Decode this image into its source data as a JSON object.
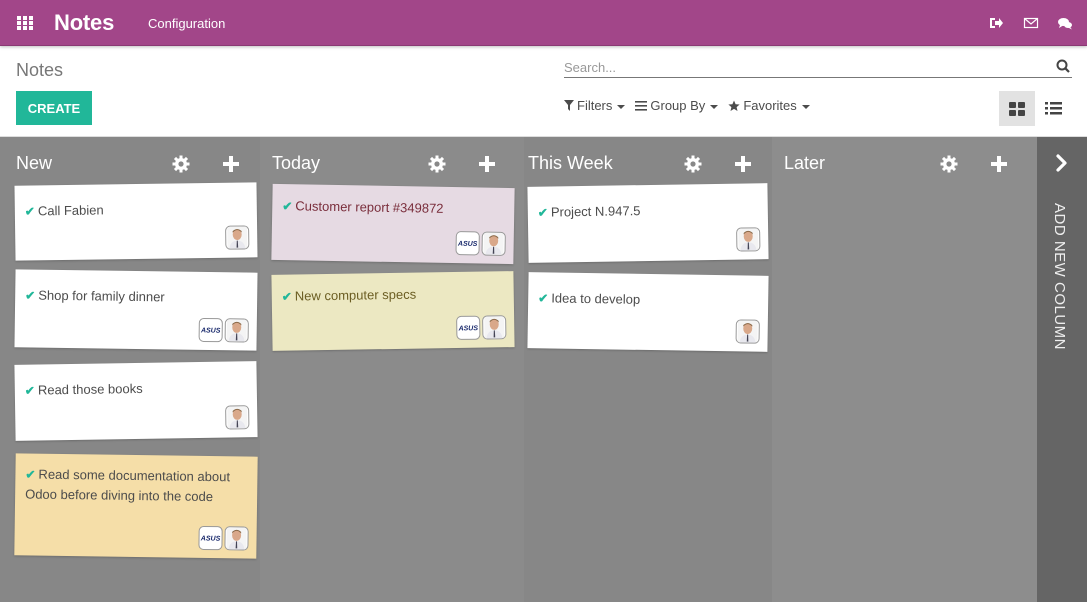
{
  "topbar": {
    "app_title": "Notes",
    "menu": [
      "Configuration"
    ],
    "brand_color": "#a24689",
    "icons": [
      "apps-icon",
      "sign-out-icon",
      "envelope-icon",
      "chat-icon"
    ]
  },
  "control_panel": {
    "breadcrumb": "Notes",
    "create_label": "CREATE",
    "create_color": "#21b799",
    "search": {
      "placeholder": "Search...",
      "value": ""
    },
    "filters_label": "Filters",
    "groupby_label": "Group By",
    "favorites_label": "Favorites",
    "views": [
      "kanban",
      "list"
    ],
    "active_view": "kanban"
  },
  "kanban": {
    "columns": [
      {
        "title": "New",
        "cards": [
          {
            "title": "Call Fabien",
            "color": "#ffffff",
            "text_color": "#4c4c4c",
            "followers": [
              "person"
            ]
          },
          {
            "title": "Shop for family dinner",
            "color": "#ffffff",
            "text_color": "#4c4c4c",
            "followers": [
              "company",
              "person"
            ]
          },
          {
            "title": "Read those books",
            "color": "#ffffff",
            "text_color": "#4c4c4c",
            "followers": [
              "person"
            ]
          },
          {
            "title": "Read some documentation about Odoo before diving into the code",
            "color": "#f5dea8",
            "text_color": "#4c4c4c",
            "followers": [
              "company",
              "person"
            ]
          }
        ]
      },
      {
        "title": "Today",
        "cards": [
          {
            "title": "Customer report #349872",
            "color": "#e6dae3",
            "text_color": "#7a2e3c",
            "followers": [
              "company",
              "person"
            ]
          },
          {
            "title": "New computer specs",
            "color": "#ece8c2",
            "text_color": "#6b5d22",
            "followers": [
              "company",
              "person"
            ]
          }
        ]
      },
      {
        "title": "This Week",
        "cards": [
          {
            "title": "Project N.947.5",
            "color": "#ffffff",
            "text_color": "#4c4c4c",
            "followers": [
              "person"
            ]
          },
          {
            "title": "Idea to develop",
            "color": "#ffffff",
            "text_color": "#4c4c4c",
            "followers": [
              "person"
            ]
          }
        ]
      },
      {
        "title": "Later",
        "cards": []
      }
    ],
    "add_column_label": "ADD NEW COLUMN"
  }
}
